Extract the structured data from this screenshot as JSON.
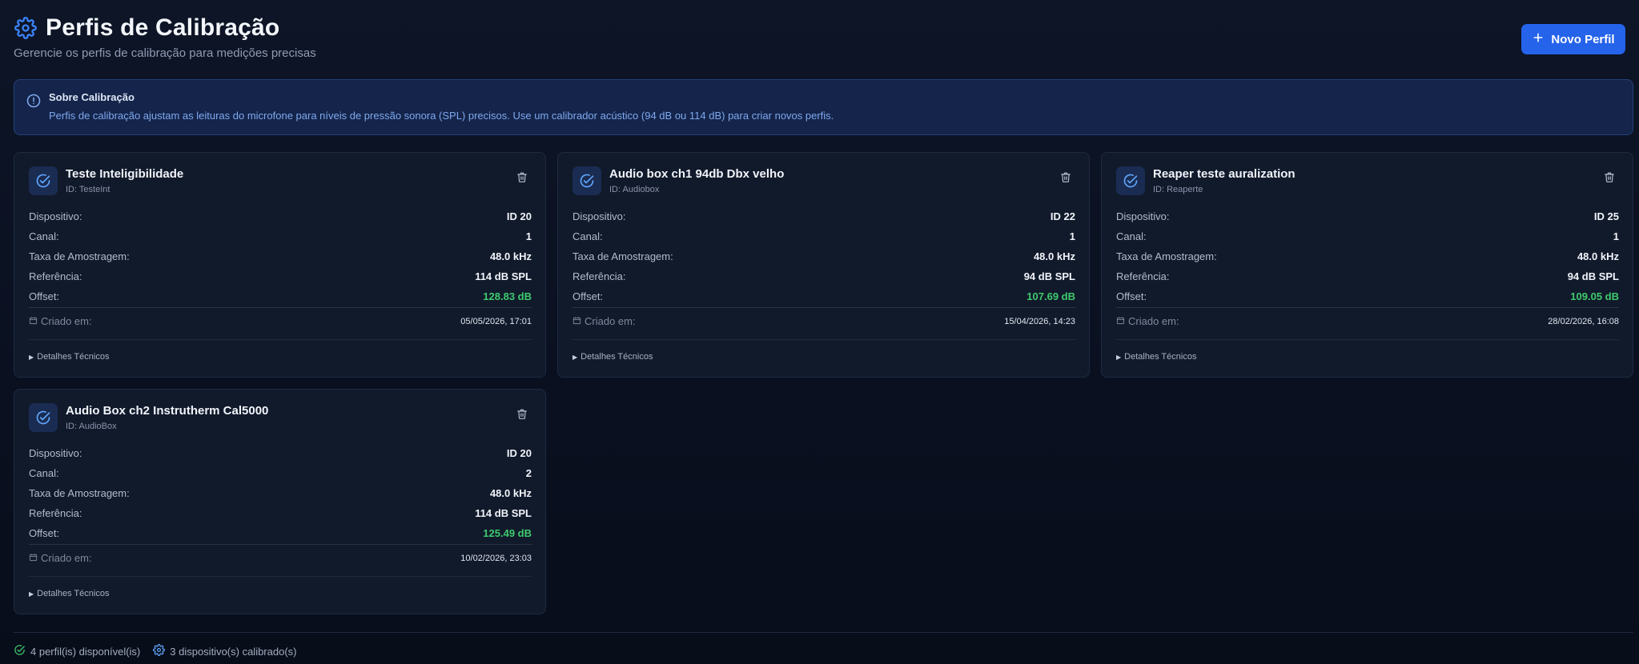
{
  "header": {
    "title": "Perfis de Calibração",
    "subtitle": "Gerencie os perfis de calibração para medições precisas",
    "new_button_label": "Novo Perfil"
  },
  "info": {
    "title": "Sobre Calibração",
    "text": "Perfis de calibração ajustam as leituras do microfone para níveis de pressão sonora (SPL) precisos. Use um calibrador acústico (94 dB ou 114 dB) para criar novos perfis."
  },
  "labels": {
    "device": "Dispositivo:",
    "channel": "Canal:",
    "sample_rate": "Taxa de Amostragem:",
    "reference": "Referência:",
    "offset": "Offset:",
    "created": "Criado em:",
    "details": "Detalhes Técnicos"
  },
  "profiles": [
    {
      "name": "Teste Inteligibilidade",
      "id": "ID: TesteInt",
      "device": "ID 20",
      "channel": "1",
      "sample_rate": "48.0 kHz",
      "reference": "114 dB SPL",
      "offset": "128.83 dB",
      "created": "05/05/2026, 17:01"
    },
    {
      "name": "Audio box ch1 94db Dbx velho",
      "id": "ID: Audiobox",
      "device": "ID 22",
      "channel": "1",
      "sample_rate": "48.0 kHz",
      "reference": "94 dB SPL",
      "offset": "107.69 dB",
      "created": "15/04/2026, 14:23"
    },
    {
      "name": "Reaper teste auralization",
      "id": "ID: Reaperte",
      "device": "ID 25",
      "channel": "1",
      "sample_rate": "48.0 kHz",
      "reference": "94 dB SPL",
      "offset": "109.05 dB",
      "created": "28/02/2026, 16:08"
    },
    {
      "name": "Audio Box ch2 Instrutherm Cal5000",
      "id": "ID: AudioBox",
      "device": "ID 20",
      "channel": "2",
      "sample_rate": "48.0 kHz",
      "reference": "114 dB SPL",
      "offset": "125.49 dB",
      "created": "10/02/2026, 23:03"
    }
  ],
  "footer": {
    "profiles_count": "4 perfil(is) disponível(is)",
    "devices_count": "3 dispositivo(s) calibrado(s)"
  },
  "colors": {
    "accent": "#2563eb",
    "offset_green": "#3fca6d",
    "background": "#0b1222",
    "card": "#111a2b"
  },
  "icons": {
    "title": "gear-icon",
    "new": "plus-icon",
    "info": "alert-circle-icon",
    "card": "check-circle-icon",
    "delete": "trash-icon",
    "created": "calendar-icon",
    "details": "triangle-right-icon",
    "footer_profiles": "check-circle-icon",
    "footer_devices": "gear-icon"
  }
}
